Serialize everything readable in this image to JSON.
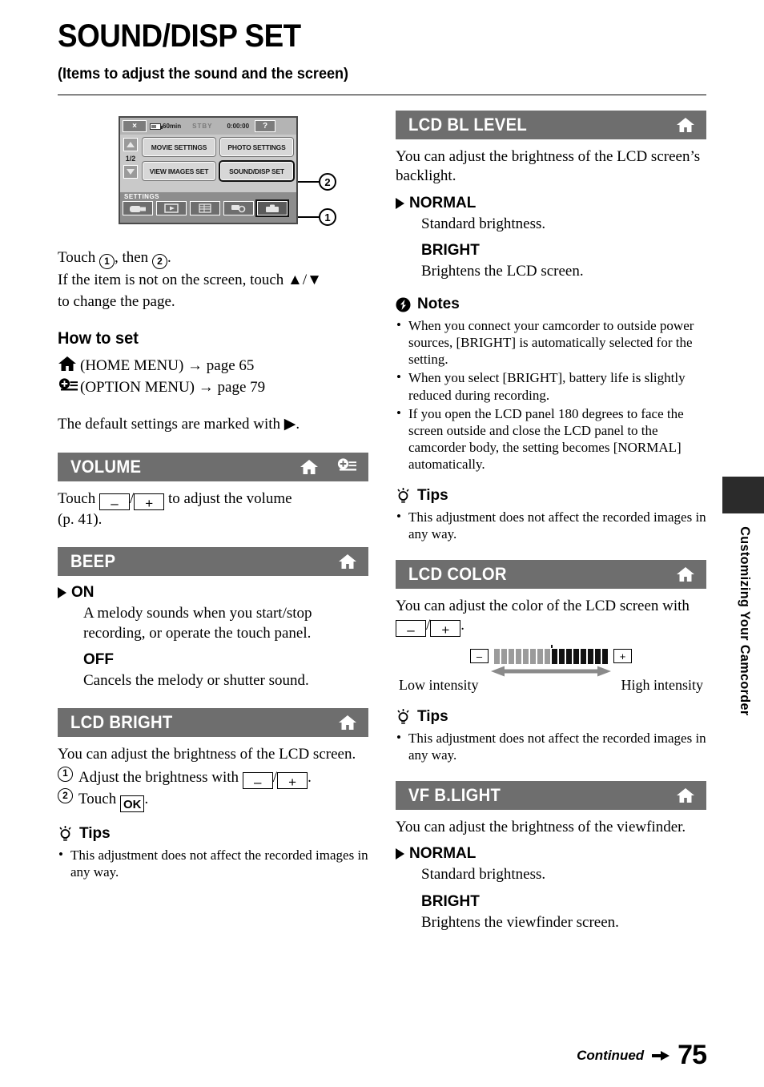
{
  "title": "SOUND/DISP SET",
  "subtitle": "(Items to adjust the sound and the screen)",
  "lcd_mock": {
    "close_label": "×",
    "battery_label": "60min",
    "status_label": "STBY",
    "timecode": "0:00:00",
    "help_label": "?",
    "page_indicator": "1/2",
    "menu_buttons": [
      "MOVIE SETTINGS",
      "PHOTO SETTINGS",
      "VIEW IMAGES SET",
      "SOUND/DISP SET"
    ],
    "settings_label": "SETTINGS",
    "toolbar_icons": [
      "camcorder-icon",
      "playback-icon",
      "list-icon",
      "media-icon",
      "toolbox-icon"
    ],
    "callout_1": "1",
    "callout_2": "2"
  },
  "intro": {
    "line1_pre": "Touch",
    "line1_num1": "1",
    "line1_mid": ", then",
    "line1_num2": "2",
    "line1_end": ".",
    "line2": "If the item is not on the screen, touch ▲/▼",
    "line3": "to change the page."
  },
  "how_to_set": {
    "heading": "How to set",
    "home_text": "(HOME MENU) → page 65",
    "option_text": "(OPTION MENU) → page 79",
    "default_note": "The default settings are marked with ▶."
  },
  "sections": {
    "volume": {
      "title": "VOLUME",
      "icons": [
        "home-icon",
        "option-menu-icon"
      ],
      "text_pre": "Touch",
      "key_minus": "–",
      "key_plus": "+",
      "text_post": "to adjust the volume",
      "text_line2": "(p. 41)."
    },
    "beep": {
      "title": "BEEP",
      "icons": [
        "home-icon"
      ],
      "options": [
        {
          "label": "ON",
          "default": true,
          "desc": "A melody sounds when you start/stop recording, or operate the touch panel."
        },
        {
          "label": "OFF",
          "default": false,
          "desc": "Cancels the melody or shutter sound."
        }
      ]
    },
    "lcd_bright": {
      "title": "LCD BRIGHT",
      "icons": [
        "home-icon"
      ],
      "intro": "You can adjust the brightness of the LCD screen.",
      "step1_num": "1",
      "step1_pre": "Adjust the brightness with",
      "step1_minus": "–",
      "step1_plus": "+",
      "step1_end": ".",
      "step2_num": "2",
      "step2_pre": "Touch",
      "step2_key": "OK",
      "step2_end": ".",
      "tips_heading": "Tips",
      "tips": [
        "This adjustment does not affect the recorded images in any way."
      ]
    },
    "lcd_bl_level": {
      "title": "LCD BL LEVEL",
      "icons": [
        "home-icon"
      ],
      "intro": "You can adjust the brightness of the LCD screen’s backlight.",
      "options": [
        {
          "label": "NORMAL",
          "default": true,
          "desc": "Standard brightness."
        },
        {
          "label": "BRIGHT",
          "default": false,
          "desc": "Brightens the LCD screen."
        }
      ],
      "notes_heading": "Notes",
      "notes": [
        "When you connect your camcorder to outside power sources, [BRIGHT] is automatically selected for the setting.",
        "When you select [BRIGHT], battery life is slightly reduced during recording.",
        "If you open the LCD panel 180 degrees to face the screen outside and close the LCD panel to the camcorder body, the setting becomes [NORMAL] automatically."
      ],
      "tips_heading": "Tips",
      "tips": [
        "This adjustment does not affect the recorded images in any way."
      ]
    },
    "lcd_color": {
      "title": "LCD COLOR",
      "icons": [
        "home-icon"
      ],
      "text_pre": "You can adjust the color of the LCD screen with",
      "key_minus": "–",
      "key_plus": "+",
      "text_end": ".",
      "scale": {
        "minus_key": "–",
        "plus_key": "+",
        "low_segments": 8,
        "high_segments": 8,
        "label_low": "Low intensity",
        "label_high": "High intensity"
      },
      "tips_heading": "Tips",
      "tips": [
        "This adjustment does not affect the recorded images in any way."
      ]
    },
    "vf_blight": {
      "title": "VF B.LIGHT",
      "icons": [
        "home-icon"
      ],
      "intro": "You can adjust the brightness of the viewfinder.",
      "options": [
        {
          "label": "NORMAL",
          "default": true,
          "desc": "Standard brightness."
        },
        {
          "label": "BRIGHT",
          "default": false,
          "desc": "Brightens the viewfinder screen."
        }
      ]
    }
  },
  "side_tab": {
    "label": "Customizing Your Camcorder"
  },
  "footer": {
    "continued": "Continued",
    "page_number": "75"
  },
  "colors": {
    "section_bar": "#6e6e6e",
    "side_tab_block": "#2b2b2b",
    "lcd_background": "#c9c9c9",
    "segment_low": "#9b9b9b",
    "segment_high": "#111111"
  }
}
